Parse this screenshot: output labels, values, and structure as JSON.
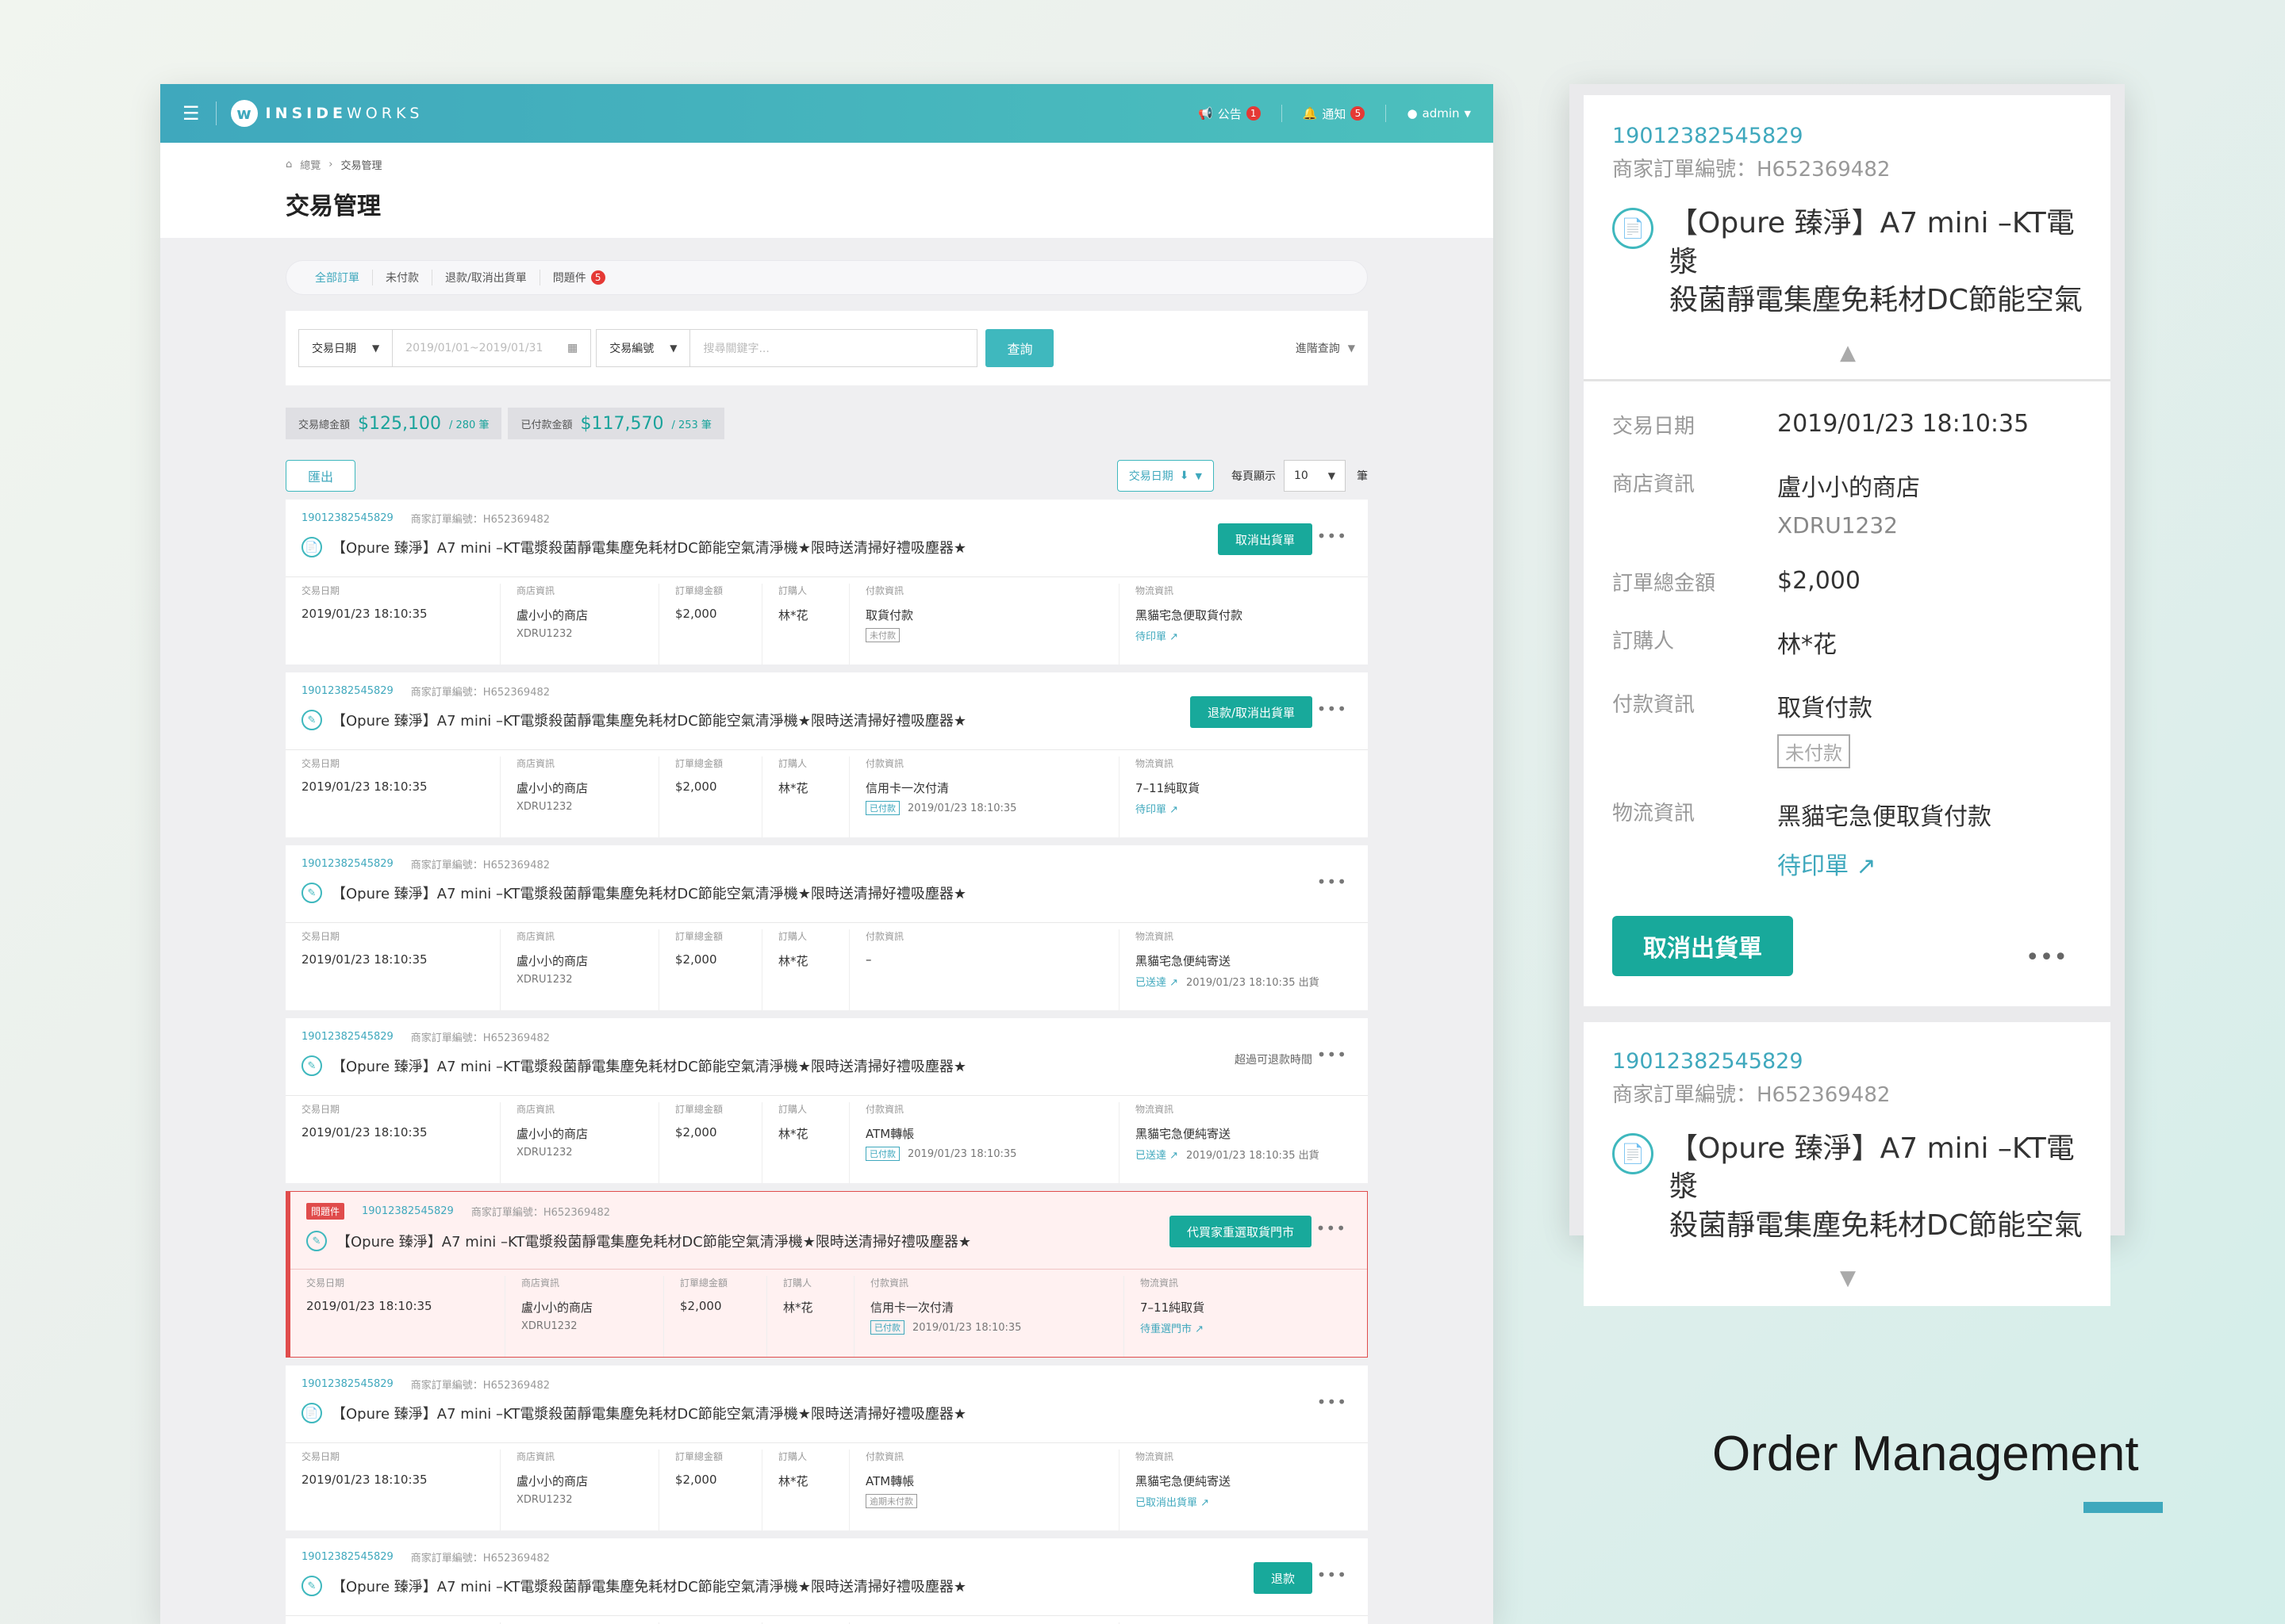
{
  "topbar": {
    "brand_letter": "w",
    "brand_a": "INSIDE",
    "brand_b": "WORKS",
    "announce_label": "公告",
    "announce_count": "1",
    "notify_label": "通知",
    "notify_count": "5",
    "user": "admin"
  },
  "breadcrumb": {
    "home": "總覽",
    "sep": "›",
    "current": "交易管理"
  },
  "page_title": "交易管理",
  "tabs": [
    {
      "label": "全部訂單"
    },
    {
      "label": "未付款"
    },
    {
      "label": "退款/取消出貨單"
    },
    {
      "label": "問題件",
      "badge": "5"
    }
  ],
  "filter": {
    "date_type": "交易日期",
    "date_range": "2019/01/01~2019/01/31",
    "search_type": "交易編號",
    "keyword_placeholder": "搜尋關鍵字...",
    "query_btn": "查詢",
    "advanced": "進階查詢"
  },
  "summary": [
    {
      "label": "交易總金額",
      "amount": "$125,100",
      "count": "/ 280 筆"
    },
    {
      "label": "已付款金額",
      "amount": "$117,570",
      "count": "/ 253 筆"
    }
  ],
  "actions": {
    "export": "匯出",
    "sort": "交易日期",
    "per_page_label": "每頁顯示",
    "per_page": "10",
    "unit": "筆"
  },
  "col_labels": {
    "date": "交易日期",
    "store": "商店資訊",
    "total": "訂單總金額",
    "buyer": "訂購人",
    "payment": "付款資訊",
    "logistics": "物流資訊"
  },
  "orders": [
    {
      "id": "19012382545829",
      "merchant": "商家訂單編號：H652369482",
      "product": "【Opure 臻淨】A7 mini –KT電漿殺菌靜電集塵免耗材DC節能空氣清淨機★限時送清掃好禮吸塵器★",
      "icon": "📄",
      "action": "取消出貨單",
      "date": "2019/01/23 18:10:35",
      "store": "盧小小的商店",
      "store_code": "XDRU1232",
      "total": "$2,000",
      "buyer": "林*花",
      "pay": "取貨付款",
      "pay_tag": "未付款",
      "pay_time": "",
      "ship": "黑貓宅急便取貨付款",
      "ship_link": "待印單 ↗",
      "ship_time": ""
    },
    {
      "id": "19012382545829",
      "merchant": "商家訂單編號：H652369482",
      "product": "【Opure 臻淨】A7 mini –KT電漿殺菌靜電集塵免耗材DC節能空氣清淨機★限時送清掃好禮吸塵器★",
      "icon": "✎",
      "action": "退款/取消出貨單",
      "date": "2019/01/23 18:10:35",
      "store": "盧小小的商店",
      "store_code": "XDRU1232",
      "total": "$2,000",
      "buyer": "林*花",
      "pay": "信用卡一次付清",
      "pay_tag": "已付款",
      "pay_time": "2019/01/23 18:10:35",
      "ship": "7–11純取貨",
      "ship_link": "待印單 ↗",
      "ship_time": ""
    },
    {
      "id": "19012382545829",
      "merchant": "商家訂單編號：H652369482",
      "product": "【Opure 臻淨】A7 mini –KT電漿殺菌靜電集塵免耗材DC節能空氣清淨機★限時送清掃好禮吸塵器★",
      "icon": "✎",
      "action": "",
      "date": "2019/01/23 18:10:35",
      "store": "盧小小的商店",
      "store_code": "XDRU1232",
      "total": "$2,000",
      "buyer": "林*花",
      "pay": "–",
      "pay_tag": "",
      "pay_time": "",
      "ship": "黑貓宅急便純寄送",
      "ship_link": "已送達 ↗",
      "ship_time": "2019/01/23 18:10:35 出貨"
    },
    {
      "id": "19012382545829",
      "merchant": "商家訂單編號：H652369482",
      "product": "【Opure 臻淨】A7 mini –KT電漿殺菌靜電集塵免耗材DC節能空氣清淨機★限時送清掃好禮吸塵器★",
      "icon": "✎",
      "note": "超過可退款時間",
      "action": "",
      "date": "2019/01/23 18:10:35",
      "store": "盧小小的商店",
      "store_code": "XDRU1232",
      "total": "$2,000",
      "buyer": "林*花",
      "pay": "ATM轉帳",
      "pay_tag": "已付款",
      "pay_time": "2019/01/23 18:10:35",
      "ship": "黑貓宅急便純寄送",
      "ship_link": "已送達 ↗",
      "ship_time": "2019/01/23 18:10:35 出貨"
    },
    {
      "id": "19012382545829",
      "merchant": "商家訂單編號：H652369482",
      "problem": "問題件",
      "product": "【Opure 臻淨】A7 mini –KT電漿殺菌靜電集塵免耗材DC節能空氣清淨機★限時送清掃好禮吸塵器★",
      "icon": "✎",
      "action": "代買家重選取貨門市",
      "date": "2019/01/23 18:10:35",
      "store": "盧小小的商店",
      "store_code": "XDRU1232",
      "total": "$2,000",
      "buyer": "林*花",
      "pay": "信用卡一次付清",
      "pay_tag": "已付款",
      "pay_time": "2019/01/23 18:10:35",
      "ship": "7–11純取貨",
      "ship_link": "待重選門市 ↗",
      "ship_time": ""
    },
    {
      "id": "19012382545829",
      "merchant": "商家訂單編號：H652369482",
      "product": "【Opure 臻淨】A7 mini –KT電漿殺菌靜電集塵免耗材DC節能空氣清淨機★限時送清掃好禮吸塵器★",
      "icon": "📄",
      "action": "",
      "date": "2019/01/23 18:10:35",
      "store": "盧小小的商店",
      "store_code": "XDRU1232",
      "total": "$2,000",
      "buyer": "林*花",
      "pay": "ATM轉帳",
      "pay_tag": "逾期未付款",
      "pay_time": "",
      "ship": "黑貓宅急便純寄送",
      "ship_link": "已取消出貨單 ↗",
      "ship_time": ""
    },
    {
      "id": "19012382545829",
      "merchant": "商家訂單編號：H652369482",
      "product": "【Opure 臻淨】A7 mini –KT電漿殺菌靜電集塵免耗材DC節能空氣清淨機★限時送清掃好禮吸塵器★",
      "icon": "✎",
      "action": "退款",
      "date": "",
      "store": "",
      "store_code": "",
      "total": "",
      "buyer": "",
      "pay": "",
      "pay_tag": "",
      "pay_time": "",
      "ship": "",
      "ship_link": "",
      "ship_time": ""
    }
  ],
  "mobile": {
    "id": "19012382545829",
    "merchant": "商家訂單編號：H652369482",
    "product_l1": "【Opure 臻淨】A7 mini –KT電漿",
    "product_l2": "殺菌靜電集塵免耗材DC節能空氣",
    "up": "▲",
    "down": "▼",
    "rows": {
      "date_label": "交易日期",
      "date": "2019/01/23 18:10:35",
      "store_label": "商店資訊",
      "store": "盧小小的商店",
      "store_code": "XDRU1232",
      "total_label": "訂單總金額",
      "total": "$2,000",
      "buyer_label": "訂購人",
      "buyer": "林*花",
      "pay_label": "付款資訊",
      "pay": "取貨付款",
      "pay_tag": "未付款",
      "ship_label": "物流資訊",
      "ship": "黑貓宅急便取貨付款",
      "ship_link": "待印單 ↗"
    },
    "action": "取消出貨單",
    "more": "•••"
  },
  "caption": "Order Management",
  "colors": {
    "brand": "#3fa8bd",
    "action": "#18a99b",
    "problem": "#e04c4c"
  }
}
